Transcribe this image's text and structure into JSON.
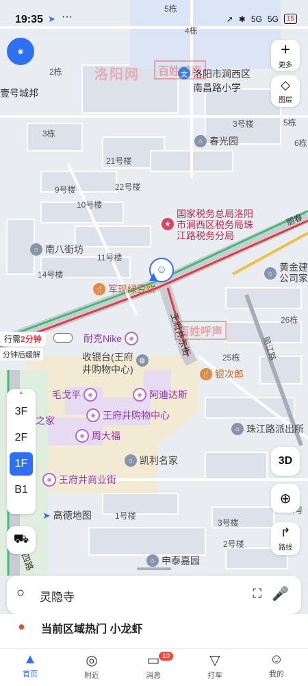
{
  "status_bar": {
    "time": "19:35",
    "signal1": "5G",
    "signal2": "5G",
    "battery": "15"
  },
  "map_labels": [
    {
      "id": "b5",
      "text": "5栋"
    },
    {
      "id": "b4",
      "text": "4栋"
    },
    {
      "id": "b2",
      "text": "2栋"
    },
    {
      "id": "b3a",
      "text": "3栋"
    },
    {
      "id": "b3b",
      "text": "3号楼"
    },
    {
      "id": "yhcb",
      "text": "壹号城邦"
    },
    {
      "id": "b21",
      "text": "21号楼"
    },
    {
      "id": "b9",
      "text": "9号楼"
    },
    {
      "id": "b22",
      "text": "22号楼"
    },
    {
      "id": "b10",
      "text": "10号楼"
    },
    {
      "id": "b11",
      "text": "11号楼"
    },
    {
      "id": "b14",
      "text": "14号楼"
    },
    {
      "id": "b1",
      "text": "1号楼"
    },
    {
      "id": "b3c",
      "text": "3号楼"
    },
    {
      "id": "b2c",
      "text": "2号楼"
    },
    {
      "id": "b26",
      "text": "26栋"
    },
    {
      "id": "b25",
      "text": "25栋"
    },
    {
      "id": "b5r",
      "text": "5栋"
    },
    {
      "id": "b6r",
      "text": "6栋"
    },
    {
      "id": "b4r",
      "text": "4号"
    },
    {
      "id": "lijiang",
      "text": "丽江路"
    },
    {
      "id": "lichun",
      "text": "丽春"
    },
    {
      "id": "wfj_street",
      "text": "王府井东街"
    }
  ],
  "pois": {
    "school": "洛阳市涧西区\n南昌路小学",
    "chunguang": "春光园",
    "tax": "国家税务总局洛阳\n市涧西区税务局珠\n江路税务分局",
    "nanba": "南八街坊",
    "junxian": "军现绿豆饼",
    "huangjin": "黄金建\n公司家",
    "nike": "耐克Nike",
    "cashier": "收银台(王府\n井购物中心)",
    "yinci": "银次郎",
    "maogeping": "毛戈平",
    "adidas": "阿迪达斯",
    "wfj_mall": "王府井购物中心",
    "zhudajia": "之家",
    "zhoudafu": "周大福",
    "zhujianglu": "珠江路派出所",
    "kaili": "凯利名家",
    "wfj_street_biz": "王府井商业街",
    "amap": "高德地图",
    "zhongtai": "申泰嘉园",
    "lu": "四路"
  },
  "traffic": {
    "label": "行需",
    "duration": "2分钟",
    "sub": "分钟后缓解"
  },
  "controls": {
    "more": "更多",
    "layers": "图层",
    "threed": "3D",
    "route": "路线"
  },
  "floors": [
    "3F",
    "2F",
    "1F",
    "B1"
  ],
  "active_floor": "1F",
  "search": {
    "value": "灵隐寺"
  },
  "hot": {
    "text": "当前区域热门 小龙虾"
  },
  "tabs": [
    {
      "label": "首页",
      "icon": "home-arrow-icon"
    },
    {
      "label": "附近",
      "icon": "location-pin-icon"
    },
    {
      "label": "消息",
      "icon": "message-icon",
      "badge": "10"
    },
    {
      "label": "打车",
      "icon": "taxi-icon"
    },
    {
      "label": "我的",
      "icon": "user-icon"
    }
  ],
  "watermark": {
    "site": "洛阳网",
    "brand": "百姓呼声"
  },
  "colors": {
    "accent": "#2f6ff1",
    "road_major": "#c9ccd2",
    "traffic_red": "#e23b3b",
    "traffic_green": "#3cbf6e",
    "mall_area": "#f3ead3"
  }
}
